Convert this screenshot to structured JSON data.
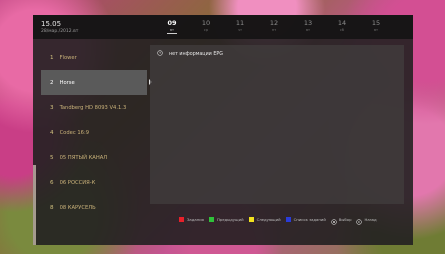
{
  "header": {
    "clock": "15.05",
    "date": "28/мар./2012.вт"
  },
  "timeline": [
    {
      "hour": "09",
      "day": "вт",
      "current": true
    },
    {
      "hour": "10",
      "day": "ср",
      "current": false
    },
    {
      "hour": "11",
      "day": "чт",
      "current": false
    },
    {
      "hour": "12",
      "day": "пт",
      "current": false
    },
    {
      "hour": "13",
      "day": "вт",
      "current": false
    },
    {
      "hour": "14",
      "day": "сб",
      "current": false
    },
    {
      "hour": "15",
      "day": "вт",
      "current": false
    }
  ],
  "channels": [
    {
      "number": "1",
      "name": "Flower"
    },
    {
      "number": "2",
      "name": "Horse",
      "selected": true
    },
    {
      "number": "3",
      "name": "Tandberg HD 8093 V4.1.3"
    },
    {
      "number": "4",
      "name": "Codec 16:9"
    },
    {
      "number": "5",
      "name": "05 ПЯТЫЙ КАНАЛ"
    },
    {
      "number": "6",
      "name": "06 РОССИЯ-К"
    },
    {
      "number": "8",
      "name": "08 КАРУСЕЛЬ"
    }
  ],
  "epg": {
    "message": "нет информации EPG",
    "icon": "clock-icon"
  },
  "legend": [
    {
      "color": "#e8202a",
      "label": "Задания",
      "icon": "red-key-icon"
    },
    {
      "color": "#2fc23a",
      "label": "Предыдущий",
      "icon": "green-key-icon"
    },
    {
      "color": "#f2e21e",
      "label": "Следующий",
      "icon": "yellow-key-icon"
    },
    {
      "color": "#2a3cd8",
      "label": "Список заданий",
      "icon": "blue-key-icon"
    },
    {
      "label": "Выбор",
      "icon": "ok-button-icon"
    },
    {
      "label": "Назад",
      "icon": "back-button-icon"
    }
  ]
}
